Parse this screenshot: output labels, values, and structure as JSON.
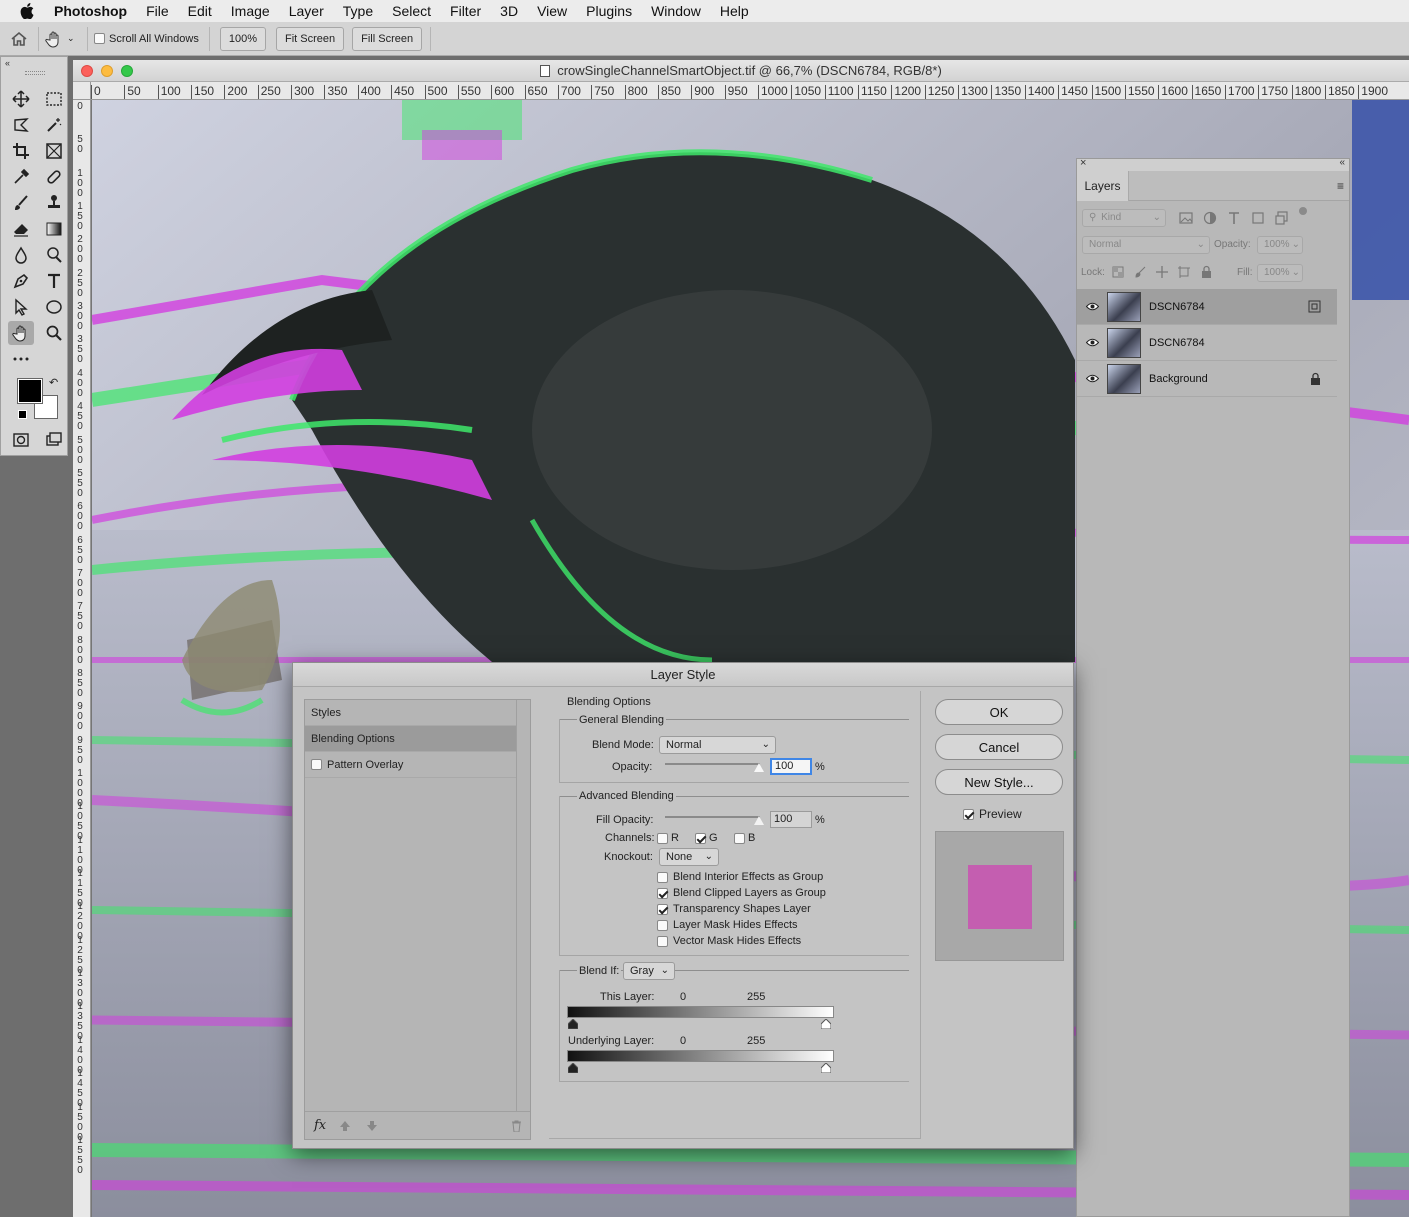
{
  "menubar": {
    "app": "Photoshop",
    "items": [
      "File",
      "Edit",
      "Image",
      "Layer",
      "Type",
      "Select",
      "Filter",
      "3D",
      "View",
      "Plugins",
      "Window",
      "Help"
    ]
  },
  "options": {
    "scroll_all": "Scroll All Windows",
    "zoom_100": "100%",
    "fit_screen": "Fit Screen",
    "fill_screen": "Fill Screen"
  },
  "document": {
    "title": "crowSingleChannelSmartObject.tif @ 66,7% (DSCN6784, RGB/8*)",
    "hruler": [
      "0",
      "50",
      "100",
      "150",
      "200",
      "250",
      "300",
      "350",
      "400",
      "450",
      "500",
      "550",
      "600",
      "650",
      "700",
      "750",
      "800",
      "850",
      "900",
      "950",
      "1000",
      "1050",
      "1100",
      "1150",
      "1200",
      "1250",
      "1300",
      "1350",
      "1400",
      "1450",
      "1500",
      "1550",
      "1600",
      "1650",
      "1700",
      "1750",
      "1800",
      "1850",
      "1900"
    ],
    "vruler": [
      "0",
      "50",
      "100",
      "150",
      "200",
      "250",
      "300",
      "350",
      "400",
      "450",
      "500",
      "550",
      "600",
      "650",
      "700",
      "750",
      "800",
      "850",
      "900",
      "950",
      "1000",
      "1050",
      "1100",
      "1150",
      "1200",
      "1250",
      "1300",
      "1350",
      "1400",
      "1450",
      "1500",
      "1550"
    ]
  },
  "layers_panel": {
    "tab": "Layers",
    "filter": "Kind",
    "blend_mode": "Normal",
    "opacity_label": "Opacity:",
    "opacity_value": "100%",
    "lock_label": "Lock:",
    "fill_label": "Fill:",
    "fill_value": "100%",
    "layers": [
      {
        "name": "DSCN6784"
      },
      {
        "name": "DSCN6784"
      },
      {
        "name": "Background"
      }
    ]
  },
  "dialog": {
    "title": "Layer Style",
    "styles_header": "Styles",
    "blending_options_item": "Blending Options",
    "pattern_overlay": "Pattern Overlay",
    "blending_options": "Blending Options",
    "general_blending": "General Blending",
    "blend_mode_label": "Blend Mode:",
    "blend_mode_value": "Normal",
    "opacity_label": "Opacity:",
    "opacity_value": "100",
    "percent": "%",
    "advanced_blending": "Advanced Blending",
    "fill_opacity_label": "Fill Opacity:",
    "fill_opacity_value": "100",
    "channels_label": "Channels:",
    "channel_r": "R",
    "channel_g": "G",
    "channel_b": "B",
    "knockout_label": "Knockout:",
    "knockout_value": "None",
    "checks": [
      {
        "label": "Blend Interior Effects as Group",
        "checked": false
      },
      {
        "label": "Blend Clipped Layers as Group",
        "checked": true
      },
      {
        "label": "Transparency Shapes Layer",
        "checked": true
      },
      {
        "label": "Layer Mask Hides Effects",
        "checked": false
      },
      {
        "label": "Vector Mask Hides Effects",
        "checked": false
      }
    ],
    "blend_if_label": "Blend If:",
    "blend_if_value": "Gray",
    "this_layer": "This Layer:",
    "underlying_layer": "Underlying Layer:",
    "low": "0",
    "high": "255",
    "ok": "OK",
    "cancel": "Cancel",
    "new_style": "New Style...",
    "preview": "Preview",
    "fx": "fx"
  },
  "colors": {
    "preview_swatch": "#c45eb0",
    "magenta": "#d23ee0",
    "green": "#3ee86a"
  }
}
